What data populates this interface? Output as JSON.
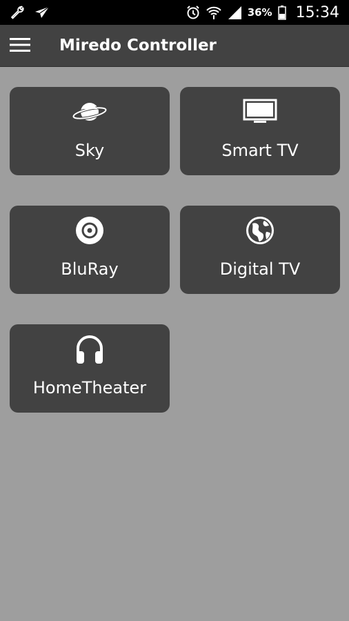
{
  "status_bar": {
    "battery_percent": "36%",
    "time": "15:34",
    "icons": [
      "wrench-icon",
      "send-icon",
      "alarm-icon",
      "wifi-icon",
      "signal-icon",
      "battery-icon"
    ]
  },
  "app_bar": {
    "menu_icon": "hamburger-menu-icon",
    "title": "Miredo Controller"
  },
  "devices": [
    {
      "label": "Sky",
      "icon": "planet-icon"
    },
    {
      "label": "Smart TV",
      "icon": "monitor-icon"
    },
    {
      "label": "BluRay",
      "icon": "disc-icon"
    },
    {
      "label": "Digital TV",
      "icon": "globe-icon"
    },
    {
      "label": "HomeTheater",
      "icon": "headphones-icon"
    }
  ],
  "colors": {
    "background": "#9e9e9e",
    "tile": "#424242",
    "app_bar": "#424242",
    "status_bar": "#000000",
    "text": "#ffffff"
  }
}
